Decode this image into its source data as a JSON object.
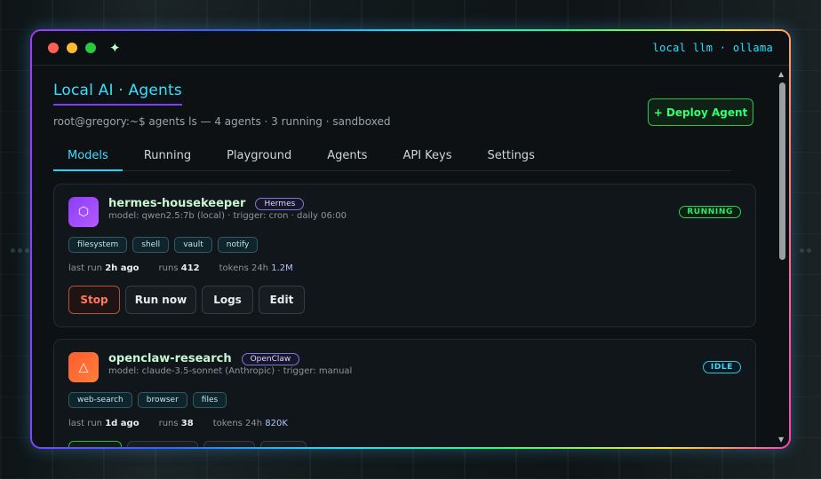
{
  "window": {
    "title_right": "local llm · ollama",
    "sparkle_icon": "sparkle-icon"
  },
  "header": {
    "title": "Local AI · Agents",
    "subtitle": "root@gregory:~$ agents ls — 4 agents · 3 running · sandboxed",
    "deploy_label": "+ Deploy Agent"
  },
  "tabs": [
    {
      "label": "Models",
      "active": true
    },
    {
      "label": "Running"
    },
    {
      "label": "Playground"
    },
    {
      "label": "Agents"
    },
    {
      "label": "API Keys"
    },
    {
      "label": "Settings"
    }
  ],
  "agents": [
    {
      "name": "hermes-housekeeper",
      "kind": "Hermes",
      "model_line": "model: qwen2.5:7b (local) · trigger: cron · daily 06:00",
      "status": "RUNNING",
      "avatar_icon": "hexagon-icon",
      "avatar_glyph": "⬡",
      "tags": [
        "filesystem",
        "shell",
        "vault",
        "notify"
      ],
      "last_run_label": "last run",
      "last_run": "2h ago",
      "runs_label": "runs",
      "runs": "412",
      "tokens_label": "tokens 24h",
      "tokens": "1.2M",
      "actions": [
        "Stop",
        "Run now",
        "Logs",
        "Edit"
      ]
    },
    {
      "name": "openclaw-research",
      "kind": "OpenClaw",
      "model_line": "model: claude-3.5-sonnet (Anthropic) · trigger: manual",
      "status": "IDLE",
      "avatar_icon": "triangle-icon",
      "avatar_glyph": "△",
      "tags": [
        "web-search",
        "browser",
        "files"
      ],
      "last_run_label": "last run",
      "last_run": "1d ago",
      "runs_label": "runs",
      "runs": "38",
      "tokens_label": "tokens 24h",
      "tokens": "820K"
    }
  ],
  "colors": {
    "accent_cyan": "#34e1ff",
    "running_green": "#2eea67",
    "stop_red": "#ff7a5e"
  }
}
